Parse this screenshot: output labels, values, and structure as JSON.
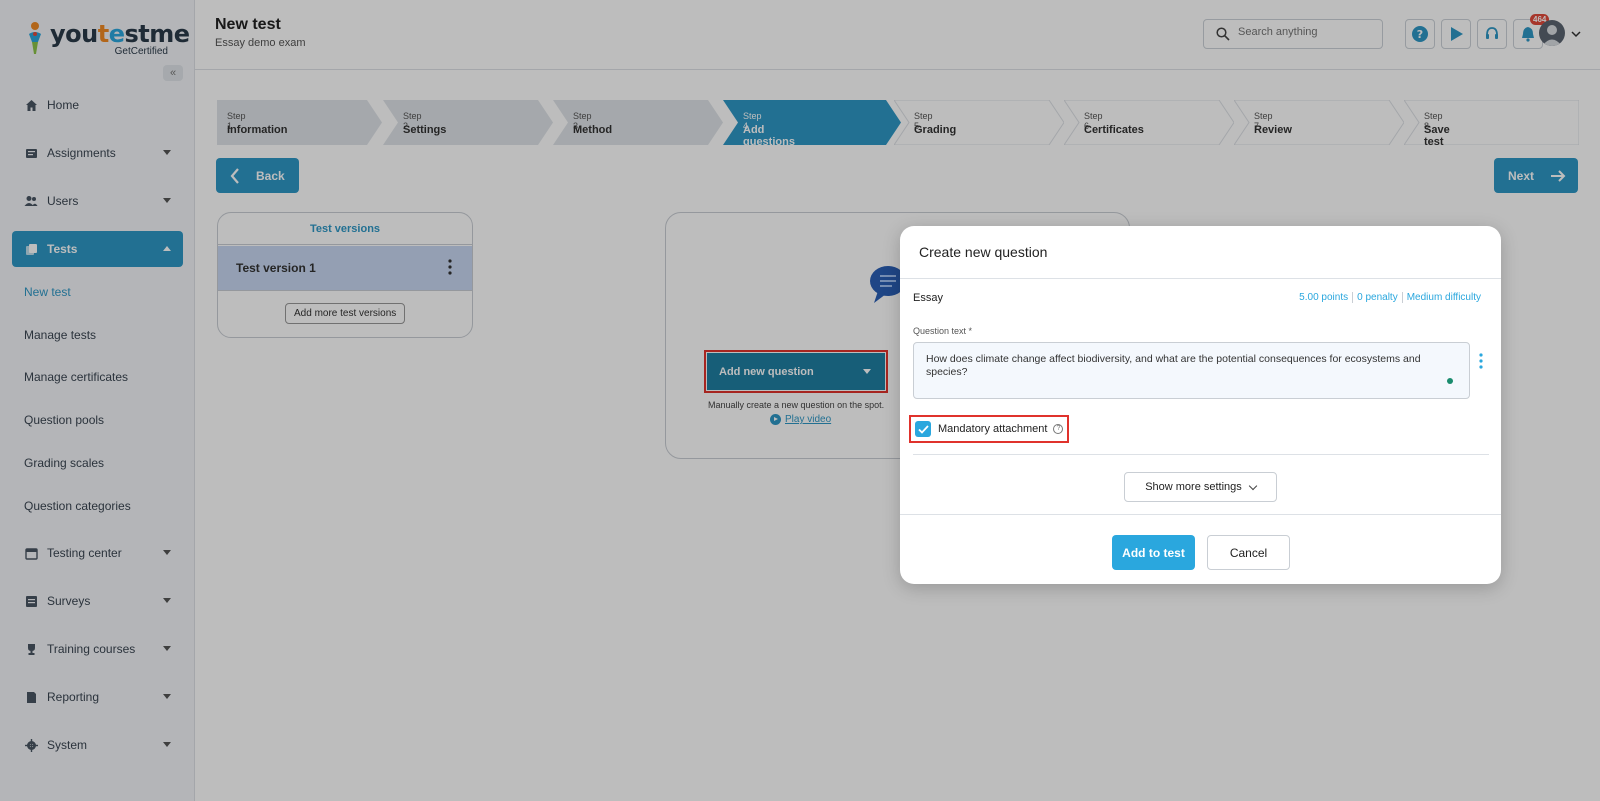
{
  "brand": {
    "name_prefix": "you",
    "name_t": "t",
    "name_e": "e",
    "name_st": "st",
    "name_suffix": "me",
    "tagline": "GetCertified"
  },
  "sidebar": {
    "collapse_glyph": "«",
    "items": [
      {
        "label": "Home",
        "icon": "home-icon"
      },
      {
        "label": "Assignments",
        "icon": "assignments-icon"
      },
      {
        "label": "Users",
        "icon": "users-icon"
      },
      {
        "label": "Tests",
        "icon": "tests-icon"
      },
      {
        "label": "Testing center",
        "icon": "calendar-icon"
      },
      {
        "label": "Surveys",
        "icon": "surveys-icon"
      },
      {
        "label": "Training courses",
        "icon": "trophy-icon"
      },
      {
        "label": "Reporting",
        "icon": "reporting-icon"
      },
      {
        "label": "System",
        "icon": "gear-icon"
      }
    ],
    "tests_subitems": [
      "New test",
      "Manage tests",
      "Manage certificates",
      "Question pools",
      "Grading scales",
      "Question categories"
    ]
  },
  "header": {
    "title": "New test",
    "subtitle": "Essay demo exam",
    "search_placeholder": "Search anything",
    "notification_count": "464"
  },
  "steps": [
    {
      "num": "Step 1",
      "label": "Information"
    },
    {
      "num": "Step 2",
      "label": "Settings"
    },
    {
      "num": "Step 3",
      "label": "Method"
    },
    {
      "num": "Step 4",
      "label": "Add questions"
    },
    {
      "num": "Step 5",
      "label": "Grading"
    },
    {
      "num": "Step 6",
      "label": "Certificates"
    },
    {
      "num": "Step 7",
      "label": "Review"
    },
    {
      "num": "Step 8",
      "label": "Save test"
    }
  ],
  "nav_buttons": {
    "back": "Back",
    "next": "Next"
  },
  "versions": {
    "header": "Test versions",
    "items": [
      "Test version 1"
    ],
    "add_label": "Add more test versions"
  },
  "empty_state": {
    "add_question_label": "Add new question",
    "hint": "Manually create a new question on the spot.",
    "play_video": "Play video"
  },
  "modal": {
    "title": "Create new question",
    "question_type": "Essay",
    "points": "5.00 points",
    "penalty": "0 penalty",
    "difficulty": "Medium difficulty",
    "question_text_label": "Question text *",
    "question_text": "How does climate change affect biodiversity, and what are the potential consequences for ecosystems and species?",
    "mandatory_label": "Mandatory attachment",
    "mandatory_checked": true,
    "show_more": "Show more settings",
    "add_to_test": "Add to test",
    "cancel": "Cancel"
  },
  "colors": {
    "primary": "#2f98c6",
    "accent": "#2aa7de",
    "highlight": "#e0322c",
    "active_step": "#2f98c6"
  }
}
